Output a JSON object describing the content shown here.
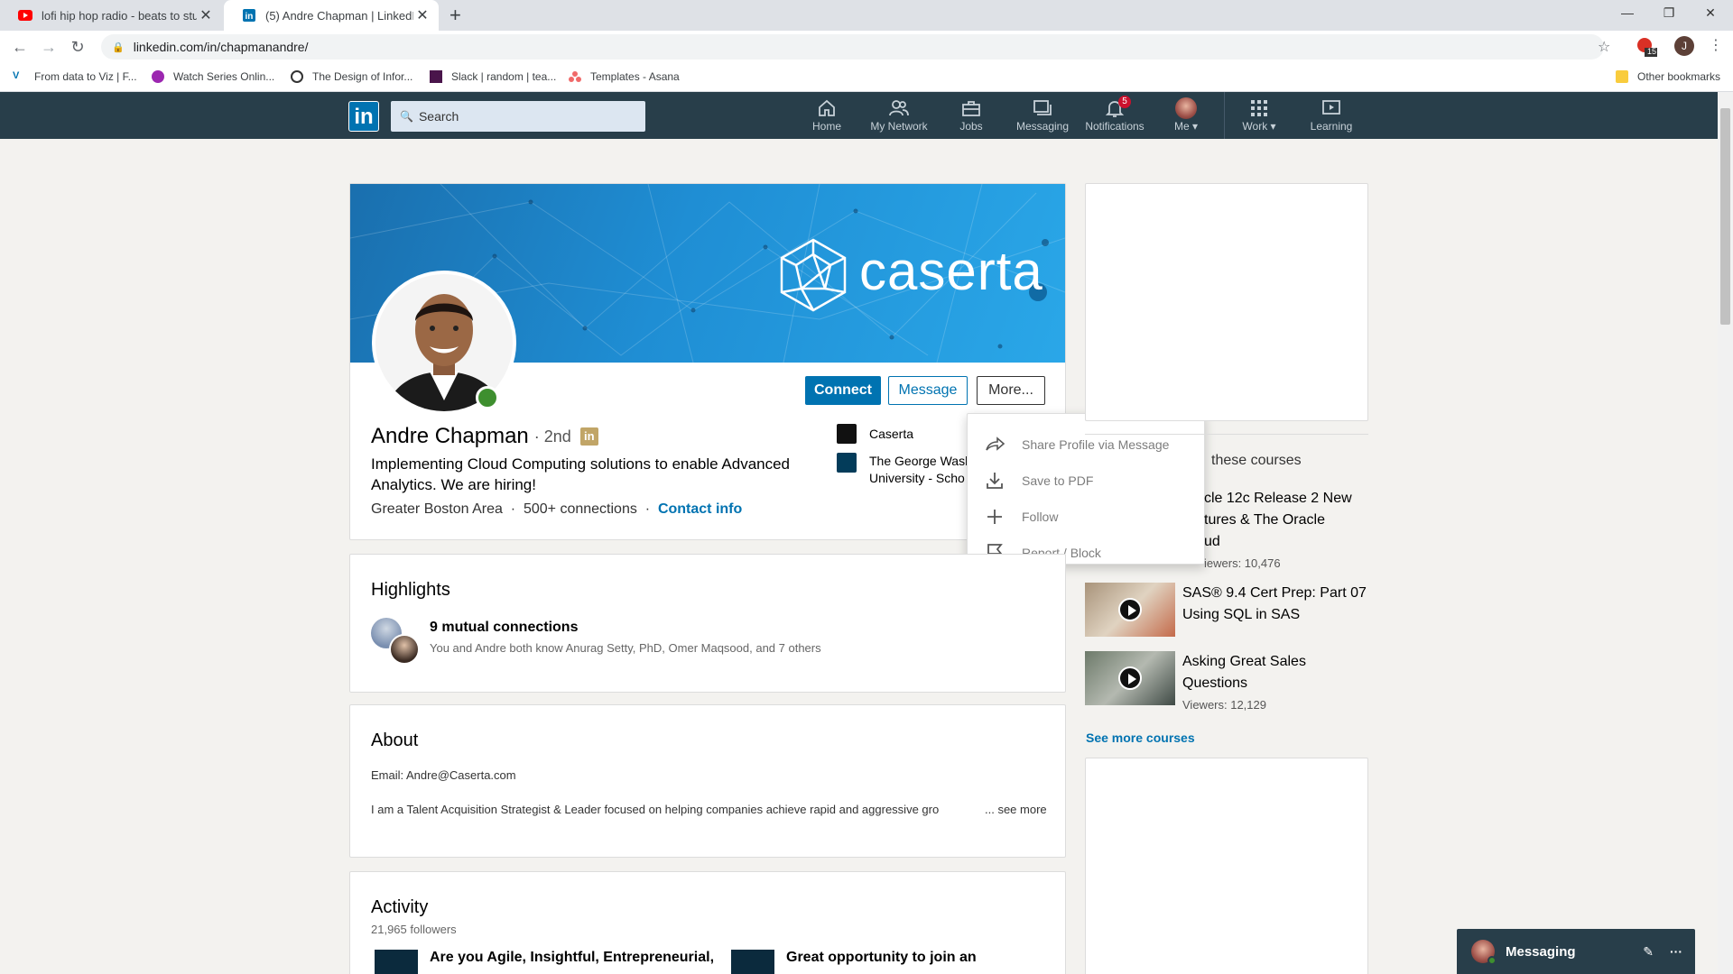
{
  "browser": {
    "tabs": [
      {
        "title": "lofi hip hop radio - beats to stud",
        "favicon": "youtube-icon"
      },
      {
        "title": "(5) Andre Chapman | LinkedIn",
        "favicon": "linkedin-icon"
      }
    ],
    "url": "linkedin.com/in/chapmanandre/",
    "profile_initial": "J",
    "extension_badge": "15",
    "bookmarks": [
      "From data to Viz | F...",
      "Watch Series Onlin...",
      "The Design of Infor...",
      "Slack | random | tea...",
      "Templates - Asana"
    ],
    "other_bookmarks": "Other bookmarks"
  },
  "nav": {
    "search_placeholder": "Search",
    "items": [
      "Home",
      "My Network",
      "Jobs",
      "Messaging",
      "Notifications",
      "Me",
      "Work",
      "Learning"
    ],
    "notifications_badge": "5"
  },
  "profile": {
    "banner_brand": "caserta",
    "name": "Andre Chapman",
    "degree": "· 2nd",
    "headline": "Implementing Cloud Computing solutions to enable Advanced Analytics. We are hiring!",
    "location": "Greater Boston Area",
    "sep1": "·",
    "connections": "500+ connections",
    "sep2": "·",
    "contact_info": "Contact info",
    "buttons": {
      "connect": "Connect",
      "message": "Message",
      "more": "More..."
    },
    "experience": [
      {
        "label": "Caserta"
      },
      {
        "label": "The George Wash",
        "label2": "University - Scho"
      }
    ]
  },
  "more_menu": {
    "items": [
      "Share Profile via Message",
      "Save to PDF",
      "Follow",
      "Report / Block"
    ]
  },
  "highlights": {
    "title": "Highlights",
    "mutual_title": "9 mutual connections",
    "mutual_detail": "You and Andre both know Anurag Setty, PhD, Omer Maqsood, and 7 others"
  },
  "about": {
    "title": "About",
    "email": "Email: Andre@Caserta.com",
    "summary": "I am a Talent Acquisition Strategist & Leader focused on helping companies achieve rapid and aggressive gro",
    "see_more": "... see more"
  },
  "activity": {
    "title": "Activity",
    "followers": "21,965 followers",
    "posts": [
      "Are you Agile, Insightful, Entrepreneurial,",
      "Great opportunity to join an"
    ]
  },
  "courses": {
    "header_fragment": "these courses",
    "items": [
      {
        "title1": "cle 12c Release 2 New",
        "title2": "tures & The Oracle",
        "title3": "ud",
        "viewers": "iewers: 10,476"
      },
      {
        "title1": "SAS® 9.4 Cert Prep: Part 07",
        "title2": "Using SQL in SAS",
        "viewers": ""
      },
      {
        "title1": "Asking Great Sales",
        "title2": "Questions",
        "viewers": "Viewers: 12,129"
      }
    ],
    "see_more": "See more courses"
  },
  "messaging": {
    "label": "Messaging"
  },
  "colors": {
    "linkedin_blue": "#0073b1",
    "nav_bg": "#283e4a",
    "badge_red": "#cb112d",
    "online_green": "#3e8f2f"
  }
}
